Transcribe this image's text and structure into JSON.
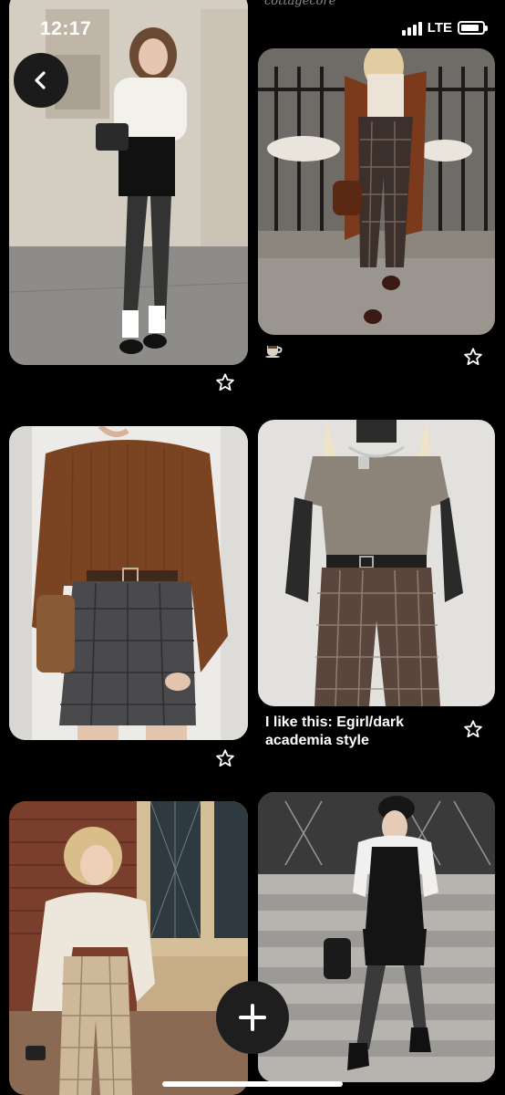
{
  "status_bar": {
    "time": "12:17",
    "network": "LTE",
    "signal_bars": 4,
    "battery_level": 0.85
  },
  "top_partial_caption": "cottagecore",
  "navigation": {
    "back_icon": "chevron-left-icon",
    "add_icon": "plus-icon"
  },
  "pins": [
    {
      "id": "pin-1",
      "image": "woman in white top, black skirt, patterned tights, stone wall",
      "caption": ""
    },
    {
      "id": "pin-2",
      "image": "woman in brown coat, plaid trousers, iron fence",
      "caption": "☕"
    },
    {
      "id": "pin-3",
      "image": "brown sweater, tweed mini skirt, leather bag",
      "caption": ""
    },
    {
      "id": "pin-4",
      "image": "grey t-shirt over black long sleeve, plaid trousers",
      "caption": "I like this: Egirl/dark academia style"
    },
    {
      "id": "pin-5",
      "image": "cream henley, plaid trousers, brick building",
      "caption": ""
    },
    {
      "id": "pin-6",
      "image": "black beret, white top, black pinafore dress, stairs",
      "caption": ""
    }
  ],
  "save_icon": "star-icon",
  "colors": {
    "background": "#000000",
    "button": "#1b1b1b",
    "text": "#ffffff"
  }
}
